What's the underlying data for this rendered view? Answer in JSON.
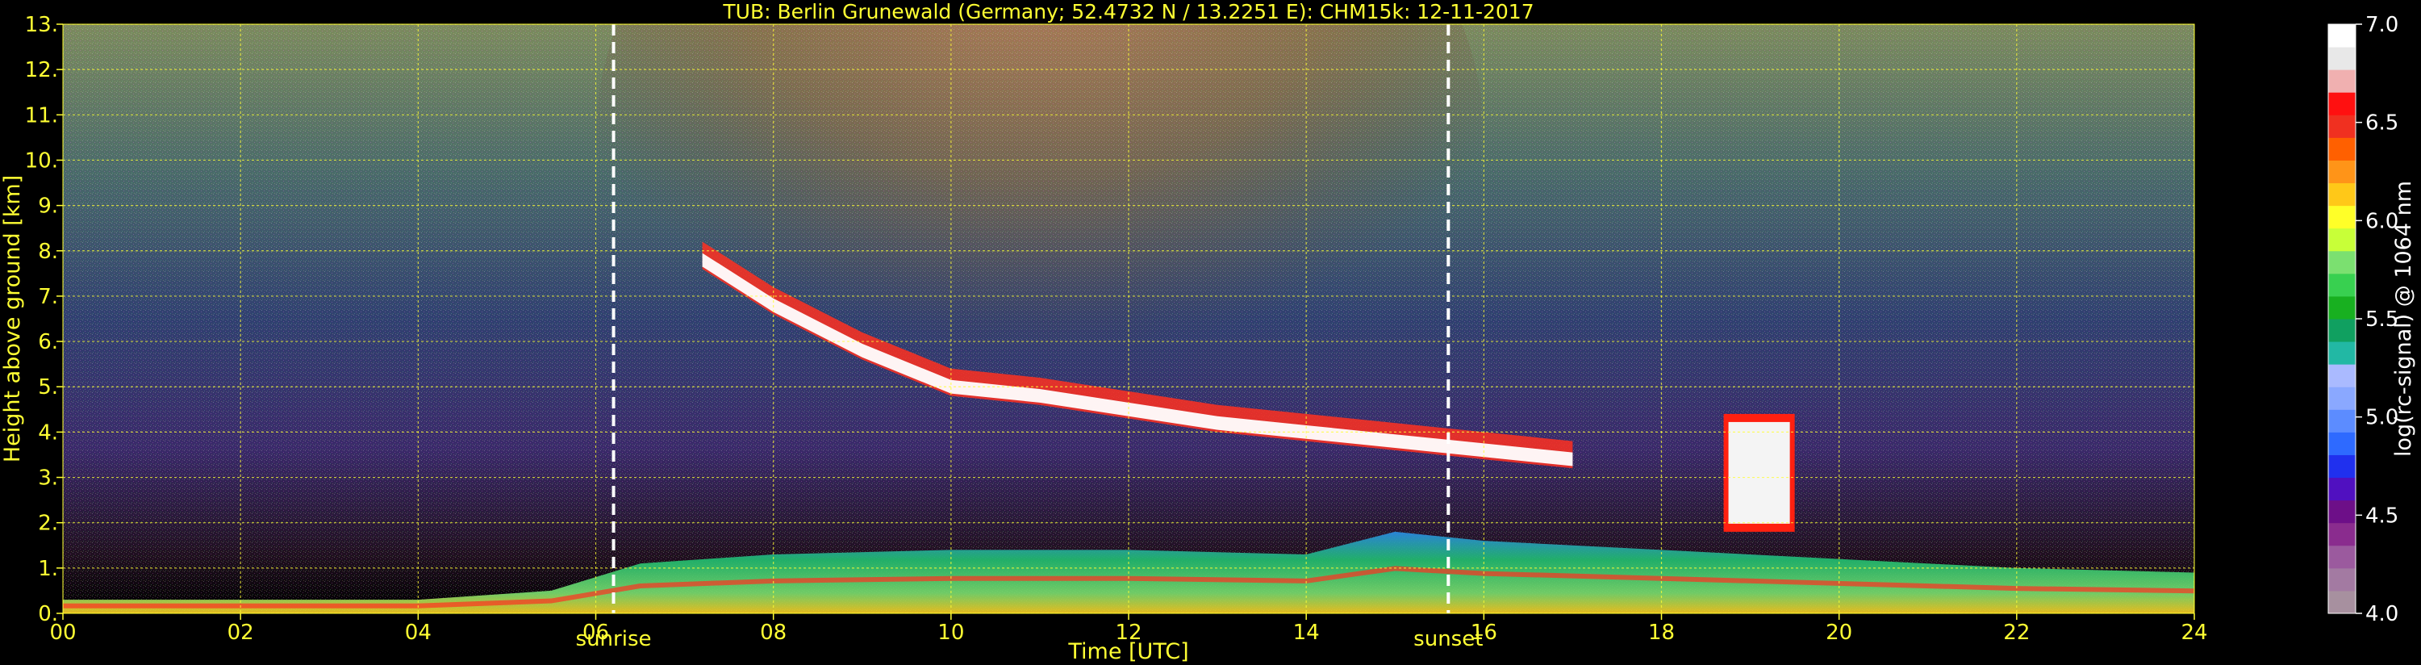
{
  "chart_data": {
    "type": "heatmap",
    "title": "TUB: Berlin Grunewald (Germany; 52.4732 N / 13.2251 E):    CHM15k: 12-11-2017",
    "xlabel": "Time [UTC]",
    "ylabel": "Height above ground [km]",
    "xlim": [
      0,
      24
    ],
    "ylim": [
      0,
      13
    ],
    "x_ticks": [
      {
        "value": 0,
        "label": "00"
      },
      {
        "value": 2,
        "label": "02"
      },
      {
        "value": 4,
        "label": "04"
      },
      {
        "value": 6,
        "label": "06"
      },
      {
        "value": 8,
        "label": "08"
      },
      {
        "value": 10,
        "label": "10"
      },
      {
        "value": 12,
        "label": "12"
      },
      {
        "value": 14,
        "label": "14"
      },
      {
        "value": 16,
        "label": "16"
      },
      {
        "value": 18,
        "label": "18"
      },
      {
        "value": 20,
        "label": "20"
      },
      {
        "value": 22,
        "label": "22"
      },
      {
        "value": 24,
        "label": "24"
      }
    ],
    "y_ticks": [
      {
        "value": 0,
        "label": "0."
      },
      {
        "value": 1,
        "label": "1."
      },
      {
        "value": 2,
        "label": "2."
      },
      {
        "value": 3,
        "label": "3."
      },
      {
        "value": 4,
        "label": "4."
      },
      {
        "value": 5,
        "label": "5."
      },
      {
        "value": 6,
        "label": "6."
      },
      {
        "value": 7,
        "label": "7."
      },
      {
        "value": 8,
        "label": "8."
      },
      {
        "value": 9,
        "label": "9."
      },
      {
        "value": 10,
        "label": "10."
      },
      {
        "value": 11,
        "label": "11."
      },
      {
        "value": 12,
        "label": "12."
      },
      {
        "value": 13,
        "label": "13."
      }
    ],
    "grid": true,
    "annotations": [
      {
        "name": "sunrise",
        "x": 6.2,
        "label": "sunrise"
      },
      {
        "name": "sunset",
        "x": 15.6,
        "label": "sunset"
      }
    ],
    "colorbar": {
      "label": "log(rc-signal) @ 1064 nm",
      "range": [
        4.0,
        7.0
      ],
      "ticks": [
        {
          "value": 4.0,
          "label": "4.0"
        },
        {
          "value": 4.5,
          "label": "4.5"
        },
        {
          "value": 5.0,
          "label": "5.0"
        },
        {
          "value": 5.5,
          "label": "5.5"
        },
        {
          "value": 6.0,
          "label": "6.0"
        },
        {
          "value": 6.5,
          "label": "6.5"
        },
        {
          "value": 7.0,
          "label": "7.0"
        }
      ],
      "colors": [
        "#a7909f",
        "#a37aa2",
        "#9b5a9e",
        "#8a2c8e",
        "#6d0f88",
        "#5010c0",
        "#2030ee",
        "#2e6aff",
        "#5c8cff",
        "#8aa8ff",
        "#aabaff",
        "#22b8a4",
        "#10a060",
        "#18b020",
        "#38d050",
        "#7be070",
        "#c8ff38",
        "#ffff28",
        "#ffc818",
        "#ff9418",
        "#ff6000",
        "#f03020",
        "#ff1010",
        "#f0b0b0",
        "#e8e8e8",
        "#ffffff"
      ]
    },
    "layers": [
      {
        "name": "boundary-layer",
        "x": [
          0,
          2,
          4,
          5.5,
          6.5,
          8,
          10,
          12,
          14,
          15,
          16,
          18,
          20,
          22,
          24
        ],
        "y_top": [
          0.3,
          0.3,
          0.3,
          0.5,
          1.1,
          1.3,
          1.4,
          1.4,
          1.3,
          1.8,
          1.6,
          1.4,
          1.2,
          1.0,
          0.9
        ]
      },
      {
        "name": "cloud-layer",
        "x": [
          7.2,
          8,
          9,
          10,
          11,
          12,
          13,
          14,
          15,
          16,
          17
        ],
        "y_base": [
          7.6,
          6.6,
          5.6,
          4.8,
          4.6,
          4.3,
          4.0,
          3.8,
          3.6,
          3.4,
          3.2
        ]
      },
      {
        "name": "low-cloud",
        "x": [
          18.7,
          19.5
        ],
        "y_range": [
          1.8,
          4.4
        ]
      }
    ]
  }
}
